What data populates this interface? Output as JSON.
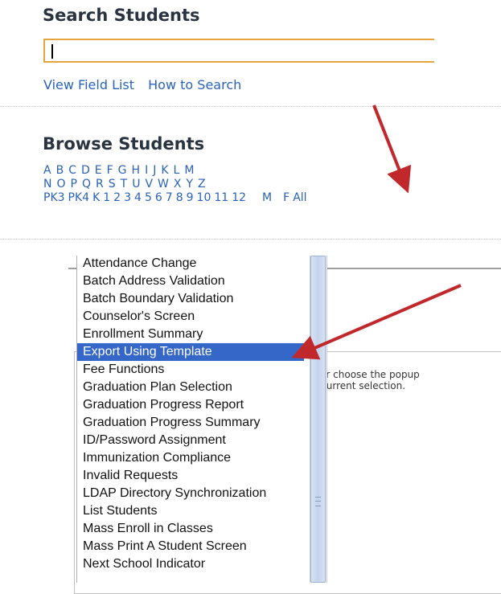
{
  "search": {
    "title": "Search Students",
    "input_value": "",
    "links": [
      "View Field List",
      "How to Search"
    ]
  },
  "browse": {
    "title": "Browse Students",
    "row1": [
      "A",
      "B",
      "C",
      "D",
      "E",
      "F",
      "G",
      "H",
      "I",
      "J",
      "K",
      "L",
      "M"
    ],
    "row2": [
      "N",
      "O",
      "P",
      "Q",
      "R",
      "S",
      "T",
      "U",
      "V",
      "W",
      "X",
      "Y",
      "Z"
    ],
    "grades": [
      "PK3",
      "PK4",
      "K",
      "1",
      "2",
      "3",
      "4",
      "5",
      "6",
      "7",
      "8",
      "9",
      "10",
      "11",
      "12"
    ],
    "gender": [
      "M",
      "F"
    ],
    "all": "All"
  },
  "functions_menu": {
    "items": [
      "Attendance Change",
      "Batch Address Validation",
      "Batch Boundary Validation",
      "Counselor's Screen",
      "Enrollment Summary",
      "Export Using Template",
      "Fee Functions",
      "Graduation Plan Selection",
      "Graduation Progress Report",
      "Graduation Progress Summary",
      "ID/Password Assignment",
      "Immunization Compliance",
      "Invalid Requests",
      "LDAP Directory Synchronization",
      "List Students",
      "Mass Enroll in Classes",
      "Mass Print A Student Screen",
      "Next School Indicator"
    ],
    "selected": "Export Using Template"
  },
  "panel": {
    "line1": "s or choose the popup",
    "line2": "e current selection."
  },
  "colors": {
    "link": "#2a62b8",
    "selection": "#3567c8",
    "search_border": "#e3a63e",
    "arrow": "#c0282c"
  }
}
